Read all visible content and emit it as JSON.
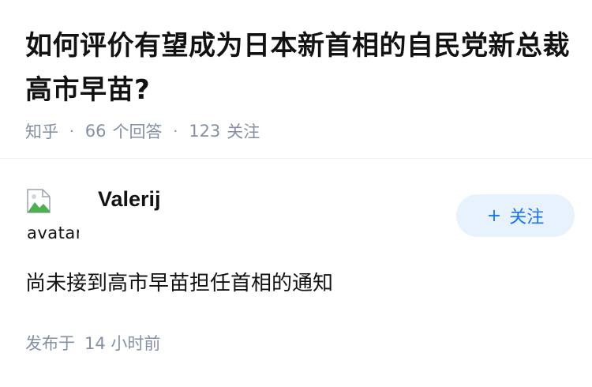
{
  "question": {
    "title": "如何评价有望成为日本新首相的自民党新总裁高市早苗?",
    "source": "知乎",
    "answer_count": "66",
    "answer_label": "个回答",
    "follower_count": "123",
    "follower_label": "关注",
    "separator": "·"
  },
  "answer": {
    "author_name": "Valerij",
    "avatar_alt": "avatar",
    "follow_button": {
      "icon": "plus-icon",
      "label": "关注"
    },
    "content": "尚未接到高市早苗担任首相的通知",
    "publish_prefix": "发布于",
    "publish_time": "14 小时前"
  },
  "colors": {
    "title": "#121212",
    "meta": "#8590a6",
    "accent": "#1772f6",
    "button_bg": "#e8f2fc",
    "divider": "#f0f2f7"
  }
}
